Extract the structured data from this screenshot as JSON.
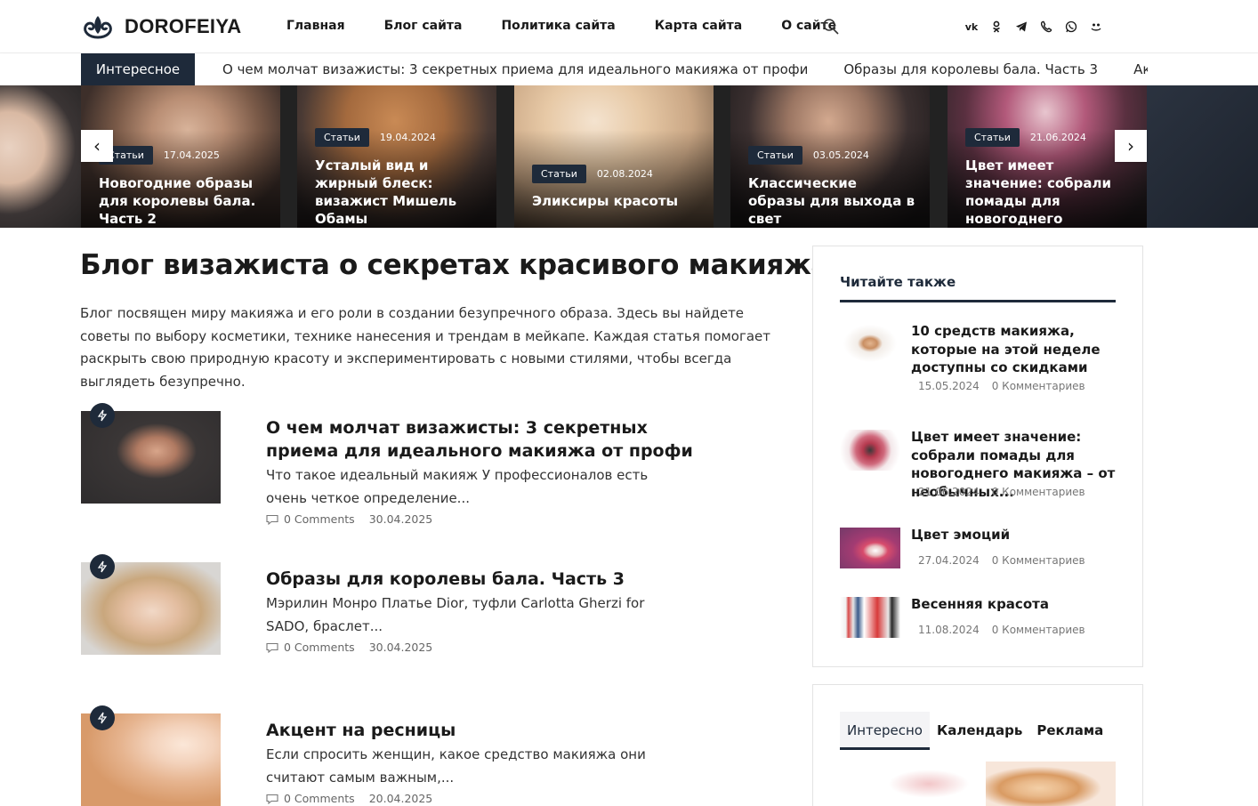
{
  "site": {
    "logo_text": "DOROFEIYA"
  },
  "nav": [
    "Главная",
    "Блог сайта",
    "Политика сайта",
    "Карта сайта",
    "О сайте"
  ],
  "socials": [
    "vk-icon",
    "ok-icon",
    "telegram-icon",
    "viber-icon",
    "whatsapp-icon",
    "moimir-icon"
  ],
  "ticker": {
    "label": "Интересное",
    "items": [
      "О чем молчат визажисты: 3 секретных приема для идеального макияжа от профи",
      "Образы для королевы бала. Часть 3",
      "Акцент на р"
    ]
  },
  "slider": {
    "prev": "‹",
    "next": "›",
    "slides": [
      {
        "badge": "Статьи",
        "date": "17.04.2025",
        "title": "Новогодние образы для королевы бала. Часть 2"
      },
      {
        "badge": "Статьи",
        "date": "19.04.2024",
        "title": "Усталый вид и жирный блеск: визажист Мишель Обамы"
      },
      {
        "badge": "Статьи",
        "date": "02.08.2024",
        "title": "Эликсиры красоты"
      },
      {
        "badge": "Статьи",
        "date": "03.05.2024",
        "title": "Классические образы для выхода в свет"
      },
      {
        "badge": "Статьи",
        "date": "21.06.2024",
        "title": "Цвет имеет значение: собрали помады для новогоднего макияжа"
      }
    ]
  },
  "main": {
    "title": "Блог визажиста о секретах красивого макияжа",
    "intro": "Блог посвящен миру макияжа и его роли в создании безупречного образа. Здесь вы найдете советы по выбору косметики, технике нанесения и трендам в мейкапе. Каждая статья помогает раскрыть свою природную красоту и экспериментировать с новыми стилями, чтобы всегда выглядеть безупречно.",
    "posts": [
      {
        "title": "О чем молчат визажисты: 3 секретных приема для идеального макияжа от профи",
        "excerpt": "Что такое идеальный макияж У профессионалов есть очень четкое определение...",
        "comments": "0 Comments",
        "date": "30.04.2025"
      },
      {
        "title": "Образы для королевы бала. Часть 3",
        "excerpt": "Мэрилин Монро Платье Dior, туфли Carlotta Gherzi for SADO, браслет...",
        "comments": "0 Comments",
        "date": "30.04.2025"
      },
      {
        "title": "Акцент на ресницы",
        "excerpt": "Если спросить женщин, какое средство макияжа они считают самым важным,...",
        "comments": "0 Comments",
        "date": "20.04.2025"
      }
    ]
  },
  "sidebar": {
    "read_also": {
      "title": "Читайте также",
      "items": [
        {
          "title": "10 средств макияжа, которые на этой неделе доступны со скидками",
          "date": "15.05.2024",
          "comments": "0 Комментариев"
        },
        {
          "title": "Цвет имеет значение: собрали помады для новогоднего макияжа – от необычных...",
          "date": "21.06.2024",
          "comments": "0 Комментариев"
        },
        {
          "title": "Цвет эмоций",
          "date": "27.04.2024",
          "comments": "0 Комментариев"
        },
        {
          "title": "Весенняя красота",
          "date": "11.08.2024",
          "comments": "0 Комментариев"
        }
      ]
    },
    "tabs": [
      "Интересно",
      "Календарь",
      "Реклама"
    ]
  },
  "colors": {
    "accent": "#1e2a3a",
    "text": "#1a1a1a"
  }
}
